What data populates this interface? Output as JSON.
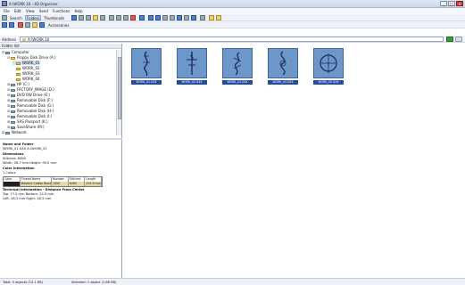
{
  "window": {
    "title": "A:\\WORK 10 - 4D Organizer",
    "controls": [
      "_",
      "□",
      "×"
    ]
  },
  "menu": [
    "File",
    "Edit",
    "View",
    "Send",
    "Functions",
    "Help"
  ],
  "toolbar1": {
    "search": "Search",
    "folders": "Folders",
    "thumbnails": "Thumbnails"
  },
  "toolbar2": {
    "accessories": "Accessories"
  },
  "address": {
    "label": "Address",
    "value": "A:\\WORK 10"
  },
  "panel": {
    "title": "Folder list"
  },
  "tree": [
    {
      "label": "Computer",
      "indent": 0,
      "expander": "⊟",
      "icon": "computer-icon"
    },
    {
      "label": "Floppy Disk Drive (A:)",
      "indent": 1,
      "expander": "⊟",
      "icon": "floppy-icon"
    },
    {
      "label": "WORK_01",
      "indent": 2,
      "expander": "",
      "icon": "folder-icon",
      "selected": true
    },
    {
      "label": "WORK_02",
      "indent": 2,
      "expander": "",
      "icon": "folder-icon"
    },
    {
      "label": "WORK_03",
      "indent": 2,
      "expander": "",
      "icon": "folder-icon"
    },
    {
      "label": "WORK_04",
      "indent": 2,
      "expander": "",
      "icon": "folder-icon"
    },
    {
      "label": "HP (C:)",
      "indent": 1,
      "expander": "⊞",
      "icon": "drive-icon"
    },
    {
      "label": "FACTORY_IMAGE (D:)",
      "indent": 1,
      "expander": "⊞",
      "icon": "drive-icon"
    },
    {
      "label": "DVD RW Drive (E:)",
      "indent": 1,
      "expander": "⊞",
      "icon": "dvd-icon"
    },
    {
      "label": "Removable Disk (F:)",
      "indent": 1,
      "expander": "⊞",
      "icon": "drive-icon"
    },
    {
      "label": "Removable Disk (G:)",
      "indent": 1,
      "expander": "⊞",
      "icon": "drive-icon"
    },
    {
      "label": "Removable Disk (H:)",
      "indent": 1,
      "expander": "⊞",
      "icon": "drive-icon"
    },
    {
      "label": "Removable Disk (I:)",
      "indent": 1,
      "expander": "⊞",
      "icon": "drive-icon"
    },
    {
      "label": "SAS Passport (K:)",
      "indent": 1,
      "expander": "⊞",
      "icon": "drive-icon"
    },
    {
      "label": "SaveShare (M:)",
      "indent": 1,
      "expander": "⊞",
      "icon": "drive-icon"
    },
    {
      "label": "Network",
      "indent": 0,
      "expander": "⊞",
      "icon": "network-icon"
    }
  ],
  "info": {
    "heading": "Name and Folder",
    "name_line": "WORK_01.XXX        A:\\WORK_01",
    "dimensions_label": "Dimensions",
    "stitches": "Stitches: 8490",
    "size": "Width: 56.7 mm      Height: 99.0 mm",
    "color_label": "Color Information",
    "colors": "1 Colors",
    "table_header": [
      "Color",
      "Thread Name",
      "Number",
      "Stitches",
      "Length"
    ],
    "table_row": [
      "",
      "Madeira Cotton Black",
      "1000",
      "8490",
      "415.9 mm"
    ],
    "tech_label": "Technical Information - Distance From Center",
    "tech_line1": "Top: 77.0 mm       Bottom: 22.0 mm",
    "tech_line2": "Left: 28.3 mm       Right: 28.3 mm"
  },
  "thumbnails": [
    {
      "caption": "WORK_01.XXX"
    },
    {
      "caption": "WORK_02.XXX"
    },
    {
      "caption": "WORK_03.XXX"
    },
    {
      "caption": "WORK_04.XXX"
    },
    {
      "caption": "WORK_05.XXX"
    }
  ],
  "status": {
    "left": "Total: 5 objects (10.1 KB)",
    "right": "Selected: 1 object (1.86 KB)"
  }
}
